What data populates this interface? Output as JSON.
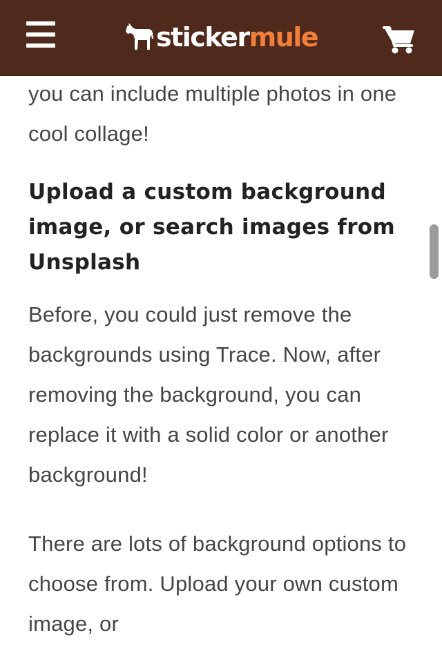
{
  "header": {
    "menu_icon": "hamburger-menu-icon",
    "logo": {
      "icon": "mule-icon",
      "word1": "sticker",
      "word2": "mule"
    },
    "cart_icon": "shopping-cart-icon",
    "background_color": "#4f2a1c",
    "accent_color": "#f07f3c"
  },
  "article": {
    "paragraph_1": "you can include multiple photos in one cool collage!",
    "heading": "Upload a custom background image, or search images from Unsplash",
    "paragraph_2": "Before, you could just remove the backgrounds using Trace. Now, after removing the background, you can replace it with a solid color or another background!",
    "paragraph_3": "There are lots of background options to choose from. Upload your own custom image, or"
  }
}
